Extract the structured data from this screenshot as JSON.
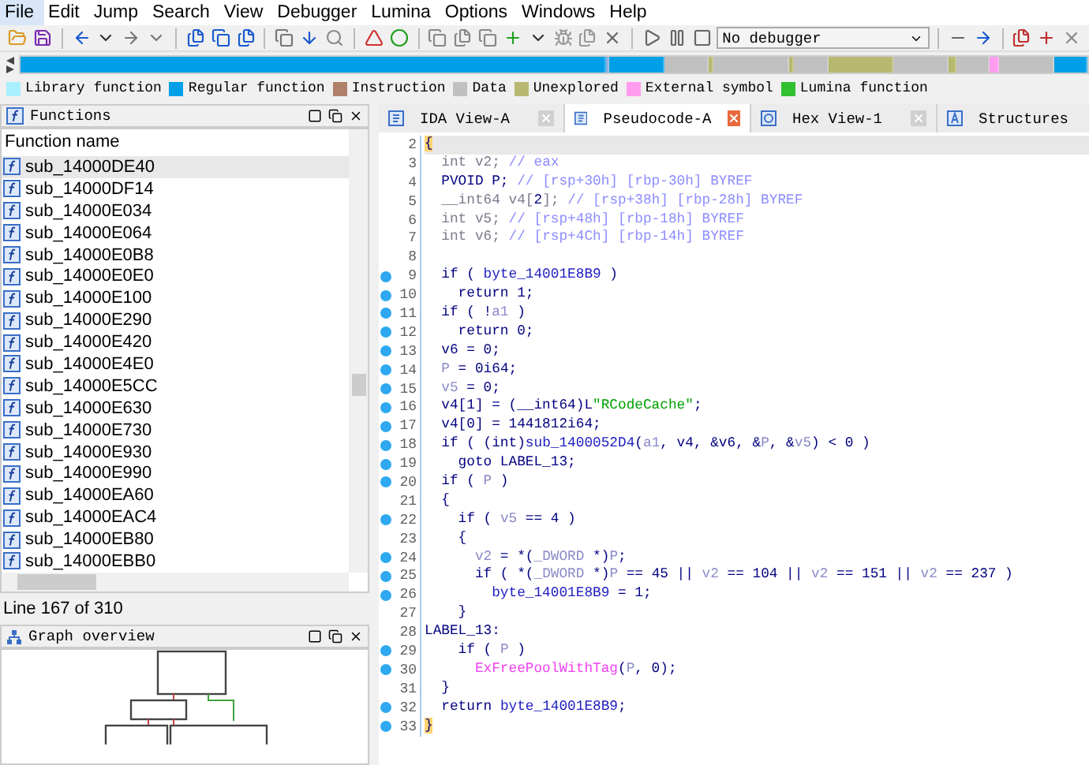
{
  "menu": [
    {
      "label": "File",
      "selected": true
    },
    {
      "label": "Edit",
      "selected": false
    },
    {
      "label": "Jump",
      "selected": false
    },
    {
      "label": "Search",
      "selected": false
    },
    {
      "label": "View",
      "selected": false
    },
    {
      "label": "Debugger",
      "selected": false
    },
    {
      "label": "Lumina",
      "selected": false
    },
    {
      "label": "Options",
      "selected": false
    },
    {
      "label": "Windows",
      "selected": false
    },
    {
      "label": "Help",
      "selected": false
    }
  ],
  "toolbar": {
    "debugger_select": "No debugger"
  },
  "legend": [
    {
      "label": "Library function",
      "color": "#a8f0ff"
    },
    {
      "label": "Regular function",
      "color": "#00a0e8"
    },
    {
      "label": "Instruction",
      "color": "#b0806a"
    },
    {
      "label": "Data",
      "color": "#c0c0c0"
    },
    {
      "label": "Unexplored",
      "color": "#b8b870"
    },
    {
      "label": "External symbol",
      "color": "#ff9cf0"
    },
    {
      "label": "Lumina function",
      "color": "#30c030"
    }
  ],
  "functions_panel": {
    "title": "Functions",
    "column": "Function name",
    "status": "Line 167 of 310",
    "rows": [
      {
        "name": "sub_14000DE40",
        "selected": true
      },
      {
        "name": "sub_14000DF14",
        "selected": false
      },
      {
        "name": "sub_14000E034",
        "selected": false
      },
      {
        "name": "sub_14000E064",
        "selected": false
      },
      {
        "name": "sub_14000E0B8",
        "selected": false
      },
      {
        "name": "sub_14000E0E0",
        "selected": false
      },
      {
        "name": "sub_14000E100",
        "selected": false
      },
      {
        "name": "sub_14000E290",
        "selected": false
      },
      {
        "name": "sub_14000E420",
        "selected": false
      },
      {
        "name": "sub_14000E4E0",
        "selected": false
      },
      {
        "name": "sub_14000E5CC",
        "selected": false
      },
      {
        "name": "sub_14000E630",
        "selected": false
      },
      {
        "name": "sub_14000E730",
        "selected": false
      },
      {
        "name": "sub_14000E930",
        "selected": false
      },
      {
        "name": "sub_14000E990",
        "selected": false
      },
      {
        "name": "sub_14000EA60",
        "selected": false
      },
      {
        "name": "sub_14000EAC4",
        "selected": false
      },
      {
        "name": "sub_14000EB80",
        "selected": false
      },
      {
        "name": "sub_14000EBB0",
        "selected": false
      }
    ]
  },
  "graph_panel": {
    "title": "Graph overview"
  },
  "tabs": [
    {
      "label": "IDA View-A",
      "kind": "disasm",
      "selected": false
    },
    {
      "label": "Pseudocode-A",
      "kind": "pseudocode",
      "selected": true
    },
    {
      "label": "Hex View-1",
      "kind": "hex",
      "selected": false
    },
    {
      "label": "Structures",
      "kind": "struct",
      "selected": false
    }
  ],
  "code_lines": [
    {
      "number": "2",
      "marker": false,
      "current": true,
      "parts": [
        {
          "kind": "brace",
          "text": "{"
        }
      ]
    },
    {
      "number": "3",
      "marker": false,
      "current": false,
      "parts": [
        {
          "kind": "dim",
          "text": "  int v2; "
        },
        {
          "kind": "comment",
          "text": "// eax"
        }
      ]
    },
    {
      "number": "4",
      "marker": false,
      "current": false,
      "parts": [
        {
          "kind": "plain",
          "text": "  PVOID P; "
        },
        {
          "kind": "comment",
          "text": "// [rsp+30h] [rbp-30h] BYREF"
        }
      ]
    },
    {
      "number": "5",
      "marker": false,
      "current": false,
      "parts": [
        {
          "kind": "dim",
          "text": "  __int64 v4["
        },
        {
          "kind": "plain",
          "text": "2"
        },
        {
          "kind": "dim",
          "text": "]; "
        },
        {
          "kind": "comment",
          "text": "// [rsp+38h] [rbp-28h] BYREF"
        }
      ]
    },
    {
      "number": "6",
      "marker": false,
      "current": false,
      "parts": [
        {
          "kind": "dim",
          "text": "  int v5; "
        },
        {
          "kind": "comment",
          "text": "// [rsp+48h] [rbp-18h] BYREF"
        }
      ]
    },
    {
      "number": "7",
      "marker": false,
      "current": false,
      "parts": [
        {
          "kind": "dim",
          "text": "  int v6; "
        },
        {
          "kind": "comment",
          "text": "// [rsp+4Ch] [rbp-14h] BYREF"
        }
      ]
    },
    {
      "number": "8",
      "marker": false,
      "current": false
    },
    {
      "number": "9",
      "marker": true,
      "current": false,
      "parts": [
        {
          "kind": "plain",
          "text": "  if ( "
        },
        {
          "kind": "global",
          "text": "byte_14001E8B9"
        },
        {
          "kind": "plain",
          "text": " )"
        }
      ]
    },
    {
      "number": "10",
      "marker": true,
      "current": false,
      "parts": [
        {
          "kind": "plain",
          "text": "    return 1;"
        }
      ]
    },
    {
      "number": "11",
      "marker": true,
      "current": false,
      "parts": [
        {
          "kind": "plain",
          "text": "  if ( !"
        },
        {
          "kind": "var",
          "text": "a1"
        },
        {
          "kind": "plain",
          "text": " )"
        }
      ]
    },
    {
      "number": "12",
      "marker": true,
      "current": false,
      "parts": [
        {
          "kind": "plain",
          "text": "    return 0;"
        }
      ]
    },
    {
      "number": "13",
      "marker": true,
      "current": false,
      "parts": [
        {
          "kind": "plain",
          "text": "  v6 = 0;"
        }
      ]
    },
    {
      "number": "14",
      "marker": true,
      "current": false,
      "parts": [
        {
          "kind": "var",
          "text": "  P"
        },
        {
          "kind": "plain",
          "text": " = 0i64;"
        }
      ]
    },
    {
      "number": "15",
      "marker": true,
      "current": false,
      "parts": [
        {
          "kind": "var",
          "text": "  v5"
        },
        {
          "kind": "plain",
          "text": " = 0;"
        }
      ]
    },
    {
      "number": "16",
      "marker": true,
      "current": false,
      "parts": [
        {
          "kind": "plain",
          "text": "  v4[1] = (__int64)L"
        },
        {
          "kind": "string",
          "text": "\"RCodeCache\""
        },
        {
          "kind": "plain",
          "text": ";"
        }
      ]
    },
    {
      "number": "17",
      "marker": true,
      "current": false,
      "parts": [
        {
          "kind": "plain",
          "text": "  v4[0] = 1441812i64;"
        }
      ]
    },
    {
      "number": "18",
      "marker": true,
      "current": false,
      "parts": [
        {
          "kind": "plain",
          "text": "  if ( (int)"
        },
        {
          "kind": "global",
          "text": "sub_1400052D4"
        },
        {
          "kind": "plain",
          "text": "("
        },
        {
          "kind": "var",
          "text": "a1"
        },
        {
          "kind": "plain",
          "text": ", v4, &v6, &"
        },
        {
          "kind": "var",
          "text": "P"
        },
        {
          "kind": "plain",
          "text": ", &"
        },
        {
          "kind": "var",
          "text": "v5"
        },
        {
          "kind": "plain",
          "text": ") < 0 )"
        }
      ]
    },
    {
      "number": "19",
      "marker": true,
      "current": false,
      "parts": [
        {
          "kind": "plain",
          "text": "    goto LABEL_13;"
        }
      ]
    },
    {
      "number": "20",
      "marker": true,
      "current": false,
      "parts": [
        {
          "kind": "plain",
          "text": "  if ( "
        },
        {
          "kind": "var",
          "text": "P"
        },
        {
          "kind": "plain",
          "text": " )"
        }
      ]
    },
    {
      "number": "21",
      "marker": false,
      "current": false,
      "parts": [
        {
          "kind": "plain",
          "text": "  {"
        }
      ]
    },
    {
      "number": "22",
      "marker": true,
      "current": false,
      "parts": [
        {
          "kind": "plain",
          "text": "    if ( "
        },
        {
          "kind": "var",
          "text": "v5"
        },
        {
          "kind": "plain",
          "text": " == 4 )"
        }
      ]
    },
    {
      "number": "23",
      "marker": false,
      "current": false,
      "parts": [
        {
          "kind": "plain",
          "text": "    {"
        }
      ]
    },
    {
      "number": "24",
      "marker": true,
      "current": false,
      "parts": [
        {
          "kind": "var",
          "text": "      v2"
        },
        {
          "kind": "plain",
          "text": " = *("
        },
        {
          "kind": "var",
          "text": "_DWORD"
        },
        {
          "kind": "plain",
          "text": " *)"
        },
        {
          "kind": "var",
          "text": "P"
        },
        {
          "kind": "plain",
          "text": ";"
        }
      ]
    },
    {
      "number": "25",
      "marker": true,
      "current": false,
      "parts": [
        {
          "kind": "plain",
          "text": "      if ( *("
        },
        {
          "kind": "var",
          "text": "_DWORD"
        },
        {
          "kind": "plain",
          "text": " *)"
        },
        {
          "kind": "var",
          "text": "P"
        },
        {
          "kind": "plain",
          "text": " == 45 || "
        },
        {
          "kind": "var",
          "text": "v2"
        },
        {
          "kind": "plain",
          "text": " == 104 || "
        },
        {
          "kind": "var",
          "text": "v2"
        },
        {
          "kind": "plain",
          "text": " == 151 || "
        },
        {
          "kind": "var",
          "text": "v2"
        },
        {
          "kind": "plain",
          "text": " == 237 )"
        }
      ]
    },
    {
      "number": "26",
      "marker": true,
      "current": false,
      "parts": [
        {
          "kind": "global",
          "text": "        byte_14001E8B9"
        },
        {
          "kind": "plain",
          "text": " = 1;"
        }
      ]
    },
    {
      "number": "27",
      "marker": false,
      "current": false,
      "parts": [
        {
          "kind": "plain",
          "text": "    }"
        }
      ]
    },
    {
      "number": "28",
      "marker": false,
      "current": false,
      "parts": [
        {
          "kind": "plain",
          "text": "LABEL_13:"
        }
      ]
    },
    {
      "number": "29",
      "marker": true,
      "current": false,
      "parts": [
        {
          "kind": "plain",
          "text": "    if ( "
        },
        {
          "kind": "var",
          "text": "P"
        },
        {
          "kind": "plain",
          "text": " )"
        }
      ]
    },
    {
      "number": "30",
      "marker": true,
      "current": false,
      "parts": [
        {
          "kind": "import",
          "text": "      ExFreePoolWithTag"
        },
        {
          "kind": "plain",
          "text": "("
        },
        {
          "kind": "var",
          "text": "P"
        },
        {
          "kind": "plain",
          "text": ", 0);"
        }
      ]
    },
    {
      "number": "31",
      "marker": false,
      "current": false,
      "parts": [
        {
          "kind": "plain",
          "text": "  }"
        }
      ]
    },
    {
      "number": "32",
      "marker": true,
      "current": false,
      "parts": [
        {
          "kind": "plain",
          "text": "  return "
        },
        {
          "kind": "global",
          "text": "byte_14001E8B9"
        },
        {
          "kind": "plain",
          "text": ";"
        }
      ]
    },
    {
      "number": "33",
      "marker": true,
      "current": false,
      "parts": [
        {
          "kind": "brace",
          "text": "}"
        }
      ]
    }
  ]
}
